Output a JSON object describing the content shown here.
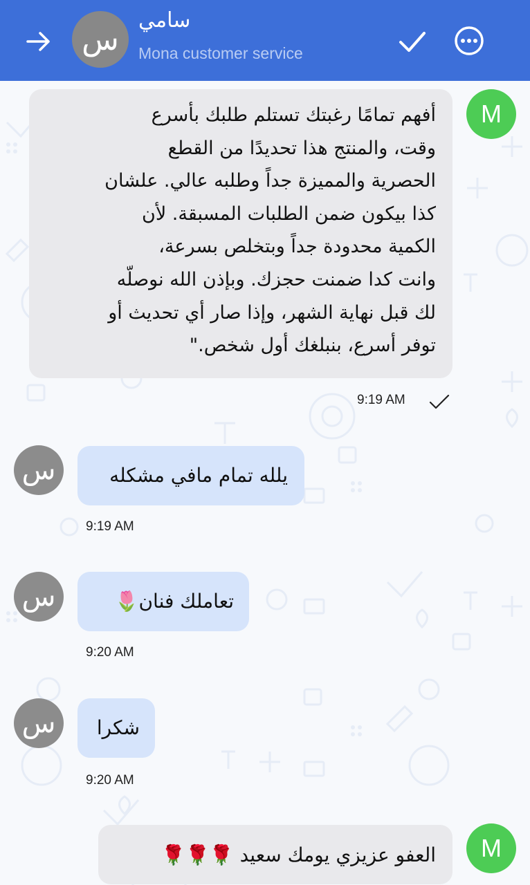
{
  "header": {
    "contact_name": "سامي",
    "subtitle": "Mona customer service",
    "avatar_letter": "س",
    "bar_color": "#3d6fd9"
  },
  "icons": {
    "back": "arrow-right-icon",
    "confirm": "checkmark-icon",
    "more": "more-options-icon",
    "read_receipt": "single-check-icon"
  },
  "messages": [
    {
      "side": "outgoing",
      "avatar_letter": "M",
      "text": "أفهم تمامًا رغبتك تستلم طلبك بأسرع\nوقت، والمنتج هذا تحديدًا من القطع\nالحصرية والمميزة جداً وطلبه عالي. علشان\nكذا بيكون ضمن الطلبات المسبقة. لأن\nالكمية محدودة جداً وبتخلص بسرعة،\nوانت كدا ضمنت حجزك. وبإذن الله نوصلّه\nلك قبل نهاية الشهر، وإذا صار أي تحديث أو\nتوفر أسرع، بنبلغك أول شخص.\"",
      "time": "9:19 AM"
    },
    {
      "side": "incoming",
      "avatar_letter": "س",
      "text": "يلله تمام مافي مشكله",
      "time": "9:19 AM"
    },
    {
      "side": "incoming",
      "avatar_letter": "س",
      "text": "تعاملك فنان🌷",
      "time": "9:20 AM"
    },
    {
      "side": "incoming",
      "avatar_letter": "س",
      "text": "شكرا",
      "time": "9:20 AM"
    },
    {
      "side": "outgoing",
      "avatar_letter": "M",
      "text": "العفو عزيزي يومك سعيد 🌹🌹🌹",
      "time": ""
    }
  ],
  "colors": {
    "outgoing_bubble": "#e9e9ec",
    "incoming_bubble": "#d6e4fb",
    "agent_avatar": "#4dcc55",
    "customer_avatar": "#8c8c8c"
  }
}
